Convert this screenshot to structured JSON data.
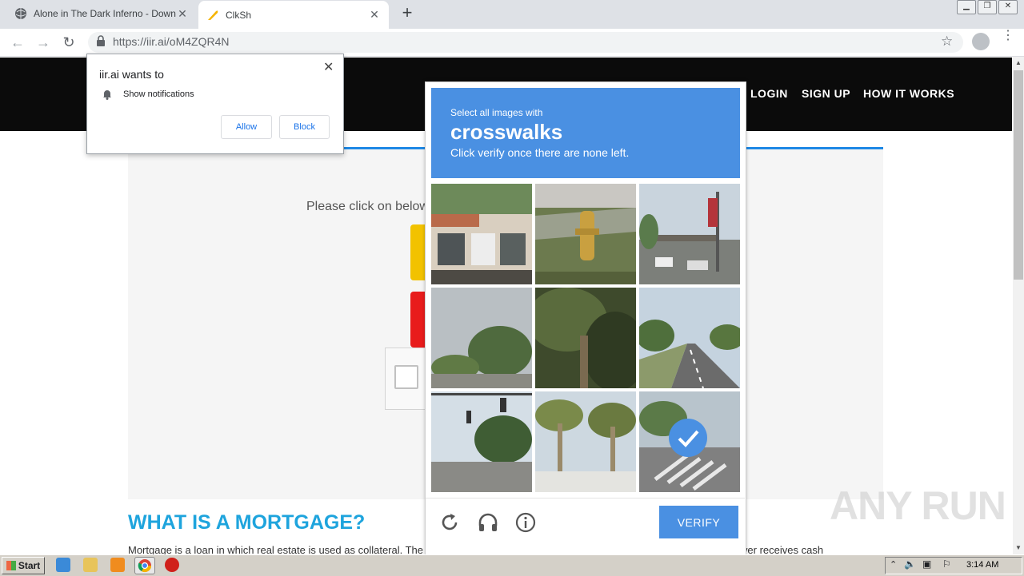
{
  "browser": {
    "tabs": [
      {
        "title": "Alone in The Dark Inferno - Downloa",
        "active": false,
        "close": "✕"
      },
      {
        "title": "ClkSh",
        "active": true,
        "close": "✕"
      }
    ],
    "new_tab": "+",
    "url": "https://iir.ai/oM4ZQR4N",
    "window_buttons": [
      "minimize",
      "restore",
      "close"
    ]
  },
  "site": {
    "nav": [
      "LOGIN",
      "SIGN UP",
      "HOW IT WORKS"
    ],
    "instruction": "Please click on below",
    "section_heading": "WHAT IS A MORTGAGE?",
    "section_text": "Mortgage is a loan in which real estate is used as collateral. The borrower enters into an agreement with the lender wherein the borrower receives cash"
  },
  "captcha": {
    "select_text": "Select all images with",
    "object": "crosswalks",
    "note": "Click verify once there are none left.",
    "verify_label": "VERIFY",
    "tiles": [
      {
        "desc": "storefront",
        "selected": false
      },
      {
        "desc": "fire hydrant",
        "selected": false
      },
      {
        "desc": "gas station",
        "selected": false
      },
      {
        "desc": "trees",
        "selected": false
      },
      {
        "desc": "palm tree",
        "selected": false
      },
      {
        "desc": "road",
        "selected": false
      },
      {
        "desc": "traffic lights",
        "selected": false
      },
      {
        "desc": "palm trees",
        "selected": false
      },
      {
        "desc": "crosswalk",
        "selected": true
      }
    ],
    "footer_icons": [
      "reload-icon",
      "audio-icon",
      "info-icon"
    ]
  },
  "notification_prompt": {
    "title": "iir.ai wants to",
    "item": "Show notifications",
    "allow": "Allow",
    "block": "Block",
    "close": "✕"
  },
  "watermark": "ANY RUN",
  "taskbar": {
    "start": "Start",
    "clock": "3:14 AM"
  },
  "colors": {
    "captcha_blue": "#4a90e2",
    "heading_blue": "#1ea4dd",
    "site_header": "#0b0b0b"
  }
}
